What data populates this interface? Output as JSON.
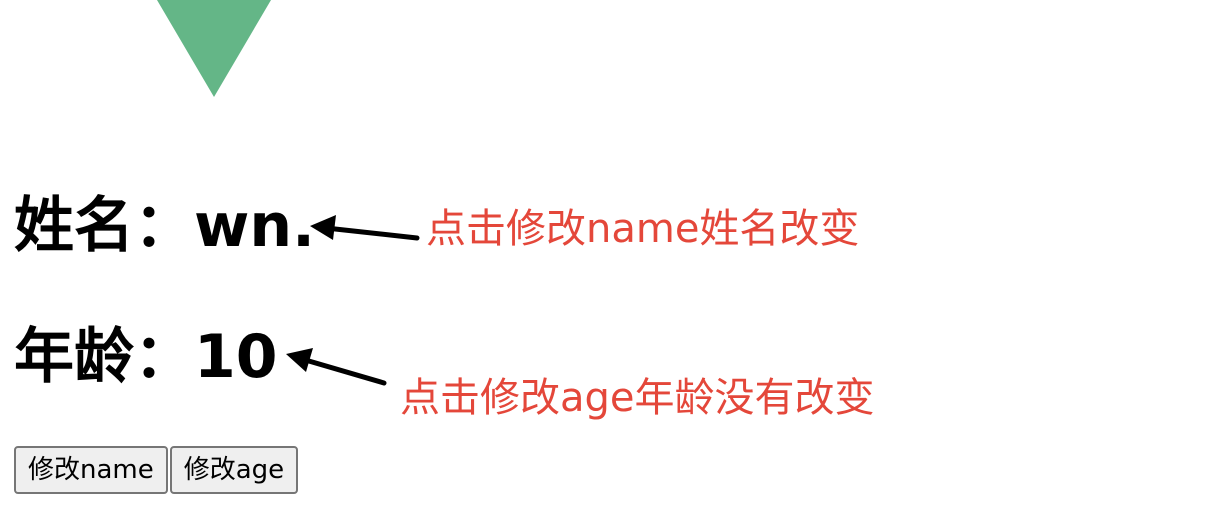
{
  "person": {
    "name_label": "姓名：",
    "name_value": "wn.",
    "age_label": "年龄：",
    "age_value": "10"
  },
  "annotations": {
    "name_note": "点击修改name姓名改变",
    "age_note": "点击修改age年龄没有改变",
    "color": "#e4473a"
  },
  "buttons": {
    "change_name": "修改name",
    "change_age": "修改age"
  },
  "logo": {
    "icon": "vue-logo-icon",
    "color": "#64b687"
  }
}
